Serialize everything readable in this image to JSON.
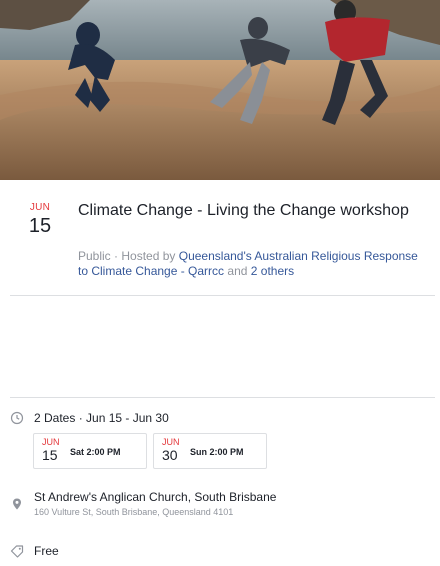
{
  "cover": {
    "colors": {
      "sky": "#8e9aa2",
      "sea": "#6f7f86",
      "sand": "#c9a27a",
      "rocks": "#6b5a48"
    }
  },
  "event": {
    "month": "JUN",
    "day": "15",
    "title": "Climate Change - Living the Change workshop",
    "privacy": "Public",
    "sep": "·",
    "hosted_prefix": "Hosted by",
    "host": "Queensland's Australian Religious Response to Climate Change - Qarrcc",
    "and_text": "and",
    "others": "2 others"
  },
  "schedule": {
    "icon": "clock-icon",
    "label": "2 Dates · Jun 15 - Jun 30",
    "dates": [
      {
        "month": "JUN",
        "day": "15",
        "time": "Sat 2:00 PM"
      },
      {
        "month": "JUN",
        "day": "30",
        "time": "Sun 2:00 PM"
      }
    ]
  },
  "location": {
    "icon": "location-pin-icon",
    "name": "St Andrew's Anglican Church, South Brisbane",
    "address": "160 Vulture St, South Brisbane, Queensland 4101"
  },
  "price": {
    "icon": "tag-icon",
    "label": "Free"
  },
  "theme": {
    "accent_red": "#e4383c",
    "link_blue": "#365899",
    "muted": "#90949c"
  }
}
